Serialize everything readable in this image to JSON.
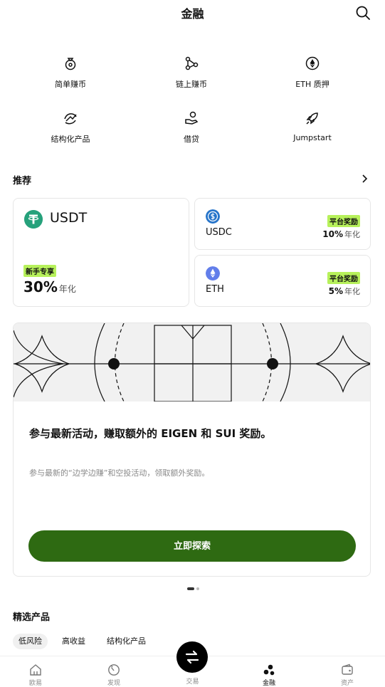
{
  "header": {
    "title": "金融"
  },
  "grid": [
    {
      "label": "简单赚币",
      "icon": "money-bag-icon"
    },
    {
      "label": "链上赚币",
      "icon": "chain-nodes-icon"
    },
    {
      "label": "ETH 质押",
      "icon": "ethereum-icon"
    },
    {
      "label": "结构化产品",
      "icon": "structured-product-icon"
    },
    {
      "label": "借贷",
      "icon": "loan-hand-icon"
    },
    {
      "label": "Jumpstart",
      "icon": "rocket-icon"
    }
  ],
  "recommend": {
    "title": "推荐",
    "cards": [
      {
        "coin": "USDT",
        "badge": "新手专享",
        "rate": "30%",
        "unit": "年化",
        "color": "#26a17b"
      },
      {
        "coin": "USDC",
        "badge": "平台奖励",
        "rate": "10%",
        "unit": "年化",
        "color": "#2775ca"
      },
      {
        "coin": "ETH",
        "badge": "平台奖励",
        "rate": "5%",
        "unit": "年化",
        "color": "#627eea"
      }
    ]
  },
  "promo": {
    "title": "参与最新活动，赚取额外的 EIGEN 和 SUI 奖励。",
    "desc": "参与最新的“边学边赚”和空投活动，领取额外奖励。",
    "button": "立即探索"
  },
  "selected": {
    "title": "精选产品",
    "filters": [
      "低风险",
      "高收益",
      "结构化产品"
    ]
  },
  "tabs": [
    {
      "label": "欧易",
      "icon": "home-icon"
    },
    {
      "label": "发现",
      "icon": "discover-icon"
    },
    {
      "label": "交易",
      "icon": "swap-icon"
    },
    {
      "label": "金融",
      "icon": "finance-dots-icon"
    },
    {
      "label": "资产",
      "icon": "wallet-icon"
    }
  ],
  "colors": {
    "accent": "#b7f15b",
    "button": "#2e6a12"
  }
}
